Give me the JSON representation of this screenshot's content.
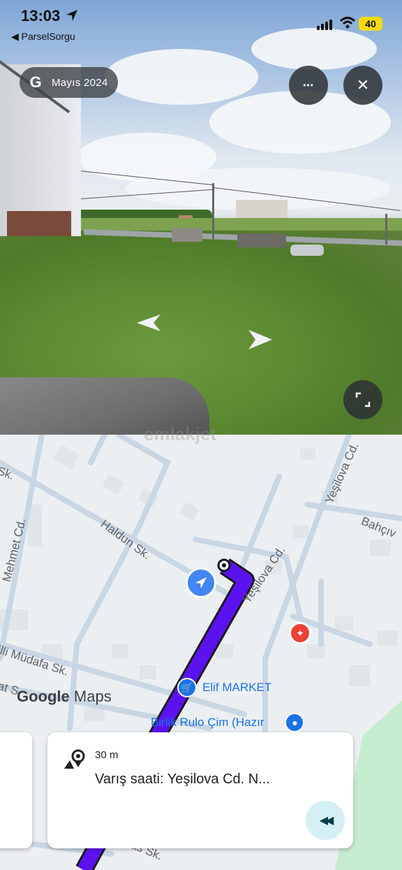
{
  "status_bar": {
    "time": "13:03",
    "back_app": "◀ ParselSorgu",
    "battery": "40"
  },
  "street_view": {
    "date_label": "Mayıs 2024",
    "brand_glyph": "G",
    "more_glyph": "•••",
    "close_glyph": "✕",
    "accent": "#3c4043"
  },
  "map": {
    "streets": [
      "Haldun Sk.",
      "Yeşilova Cd.",
      "Yeşilova Cd.",
      "Bahçıv",
      "Mehmet Cd.",
      "Sk.",
      "illi Müdafa Sk.",
      "at S",
      "yas Sk."
    ],
    "watermark": "emlakjet",
    "logo": {
      "google": "Google",
      "maps": "Maps"
    },
    "pois": [
      {
        "name": "Elif MARKET",
        "icon": "shopping-cart-icon"
      },
      {
        "name": "Birlik Rulo Çim (Hazır",
        "icon": "pin-icon"
      }
    ],
    "route_color": "#5b12f0",
    "water_color": "#c6ecd0"
  },
  "nav_card": {
    "distance": "30 m",
    "eta": "Varış saati: Yeşilova Cd. N...",
    "rewind_glyph": "◀◀"
  }
}
